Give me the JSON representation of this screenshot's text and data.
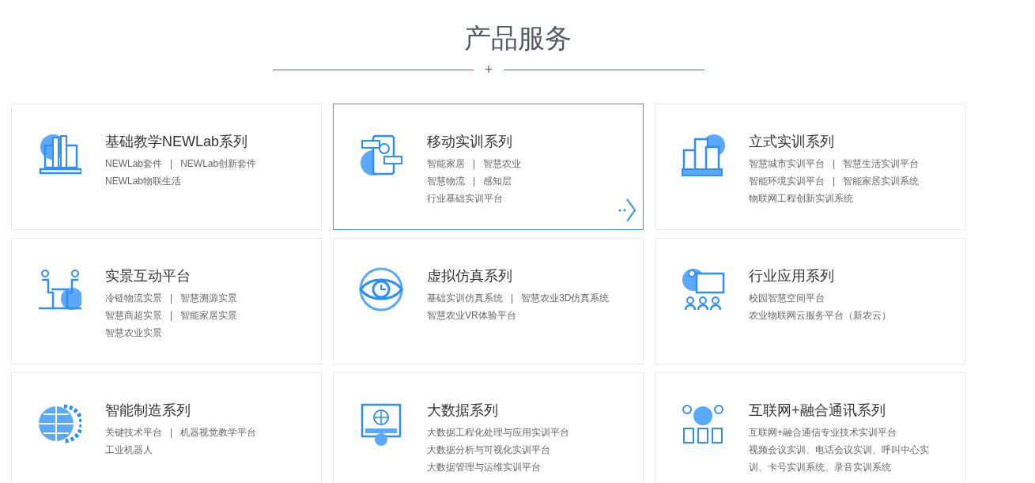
{
  "heading": {
    "title": "产品服务",
    "divider_mark": "+"
  },
  "cards": [
    {
      "title": "基础教学NEWLab系列",
      "selected": false,
      "lines": [
        [
          "NEWLab套件",
          "|",
          "NEWLab创新套件"
        ],
        [
          "NEWLab物联生活"
        ]
      ]
    },
    {
      "title": "移动实训系列",
      "selected": true,
      "lines": [
        [
          "智能家居",
          "|",
          "智慧农业"
        ],
        [
          "智慧物流",
          "|",
          "感知层"
        ],
        [
          "行业基础实训平台"
        ]
      ]
    },
    {
      "title": "立式实训系列",
      "selected": false,
      "lines": [
        [
          "智慧城市实训平台",
          "|",
          "智慧生活实训平台"
        ],
        [
          "智能环境实训平台",
          "|",
          "智能家居实训系统"
        ],
        [
          "物联网工程创新实训系统"
        ]
      ]
    },
    {
      "title": "实景互动平台",
      "selected": false,
      "lines": [
        [
          "冷链物流实景",
          "|",
          "智慧溯源实景"
        ],
        [
          "智慧商超实景",
          "|",
          "智能家居实景"
        ],
        [
          "智慧农业实景"
        ]
      ]
    },
    {
      "title": "虚拟仿真系列",
      "selected": false,
      "lines": [
        [
          "基础实训仿真系统",
          "|",
          "智慧农业3D仿真系统"
        ],
        [
          "智慧农业VR体验平台"
        ]
      ]
    },
    {
      "title": "行业应用系列",
      "selected": false,
      "lines": [
        [
          "校园智慧空间平台"
        ],
        [
          "农业物联网云服务平台（新农云）"
        ]
      ]
    },
    {
      "title": "智能制造系列",
      "selected": false,
      "lines": [
        [
          "关键技术平台",
          "|",
          "机器视觉教学平台"
        ],
        [
          "工业机器人"
        ]
      ]
    },
    {
      "title": "大数据系列",
      "selected": false,
      "lines": [
        [
          "大数据工程化处理与应用实训平台"
        ],
        [
          "大数据分析与可视化实训平台"
        ],
        [
          "大数据管理与运维实训平台"
        ]
      ]
    },
    {
      "title": "互联网+融合通讯系列",
      "selected": false,
      "lines": [
        [
          "互联网+融合通信专业技术实训平台"
        ],
        [
          "视频会议实训、电话会议实训、呼叫中心实训、卡号实训系统、录音实训系统"
        ]
      ]
    }
  ]
}
